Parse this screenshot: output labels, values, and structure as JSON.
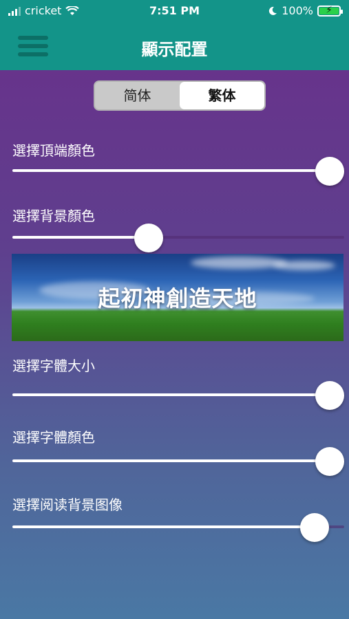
{
  "status": {
    "carrier": "cricket",
    "time": "7:51 PM",
    "battery": "100%"
  },
  "nav": {
    "title": "顯示配置"
  },
  "segment": {
    "options": [
      "简体",
      "繁体"
    ],
    "selected": "繁体"
  },
  "settings": [
    {
      "label": "選擇頂端顏色",
      "value": 1.0
    },
    {
      "label": "選擇背景顏色",
      "value": 0.41
    },
    {
      "label": "選擇字體大小",
      "value": 0.99
    },
    {
      "label": "選擇字體顏色",
      "value": 0.99
    },
    {
      "label": "選擇阅读背景图像",
      "value": 0.91
    }
  ],
  "preview": {
    "text": "起初神創造天地"
  }
}
